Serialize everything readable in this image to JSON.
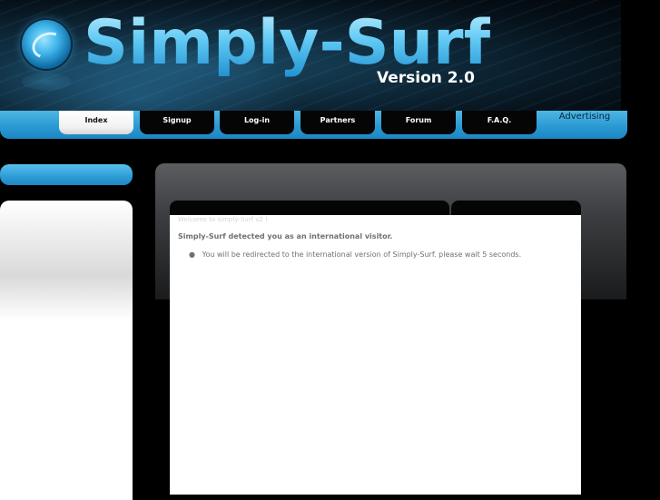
{
  "header": {
    "title": "Simply-Surf",
    "version": "Version 2.0"
  },
  "nav": {
    "tabs": [
      {
        "label": "Index",
        "active": true
      },
      {
        "label": "Signup",
        "active": false
      },
      {
        "label": "Log-in",
        "active": false
      },
      {
        "label": "Partners",
        "active": false
      },
      {
        "label": "Forum",
        "active": false
      },
      {
        "label": "F.A.Q.",
        "active": false
      }
    ],
    "advertising": "Advertising"
  },
  "content": {
    "welcome": "Welcome to simply-Surf v2 !",
    "detected": "Simply-Surf detected you as an international visitor.",
    "redirect": "You will be redirected to the international version of Simply-Surf. please wait 5 seconds."
  },
  "colors": {
    "accent": "#2b9ad3",
    "background": "#000000",
    "nav_tab": "#050505"
  },
  "icons": {
    "logo": "surf-orb-icon"
  }
}
